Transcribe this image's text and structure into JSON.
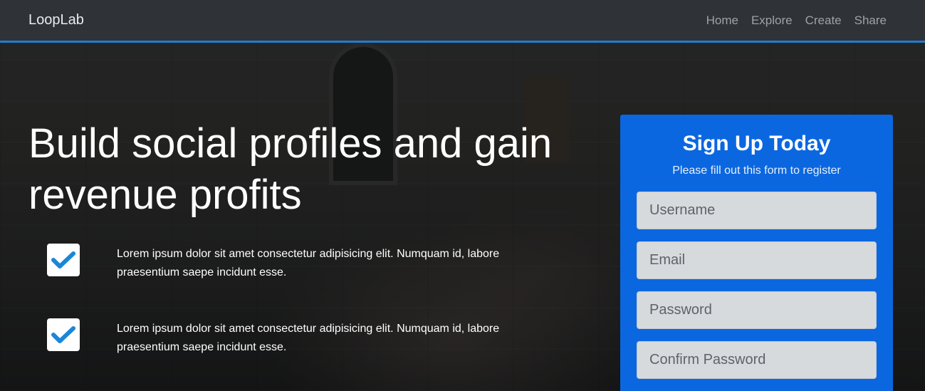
{
  "navbar": {
    "brand": "LoopLab",
    "links": [
      "Home",
      "Explore",
      "Create",
      "Share"
    ],
    "accent_color": "#1d7fd0"
  },
  "hero": {
    "headline": "Build social profiles and gain revenue profits",
    "features": [
      "Lorem ipsum dolor sit amet consectetur adipisicing elit. Numquam id, labore praesentium saepe incidunt esse.",
      "Lorem ipsum dolor sit amet consectetur adipisicing elit. Numquam id, labore praesentium saepe incidunt esse."
    ],
    "feature_icon": "checkmark-icon",
    "check_color": "#1a86d8"
  },
  "signup": {
    "title": "Sign Up Today",
    "subtitle": "Please fill out this form to register",
    "background_color": "#0b67e0",
    "fields": {
      "username": "Username",
      "email": "Email",
      "password": "Password",
      "confirm_password": "Confirm Password"
    }
  }
}
